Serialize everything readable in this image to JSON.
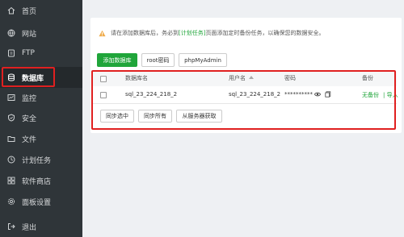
{
  "sidebar": {
    "items": [
      {
        "label": "首页",
        "icon": "home-icon"
      },
      {
        "label": "网站",
        "icon": "globe-icon"
      },
      {
        "label": "FTP",
        "icon": "ftp-icon"
      },
      {
        "label": "数据库",
        "icon": "database-icon",
        "active": true
      },
      {
        "label": "监控",
        "icon": "monitor-icon"
      },
      {
        "label": "安全",
        "icon": "shield-icon"
      },
      {
        "label": "文件",
        "icon": "folder-icon"
      },
      {
        "label": "计划任务",
        "icon": "clock-icon"
      },
      {
        "label": "软件商店",
        "icon": "store-icon"
      },
      {
        "label": "面板设置",
        "icon": "gear-icon"
      },
      {
        "label": "退出",
        "icon": "logout-icon"
      }
    ]
  },
  "tip": {
    "before": "请在添加数据库后，务必到",
    "link": "[计划任务]",
    "after": "页面添加定时备份任务，以确保您的数据安全。"
  },
  "toolbar": {
    "add_label": "添加数据库",
    "root_label": "root密码",
    "pma_label": "phpMyAdmin"
  },
  "table": {
    "headers": {
      "name": "数据库名",
      "user": "用户名",
      "password": "密码",
      "backup": "备份"
    },
    "rows": [
      {
        "name": "sql_23_224_218_2",
        "user": "sql_23_224_218_2",
        "password": "**********",
        "backup": "无备份",
        "import": "| 导入"
      }
    ]
  },
  "sync": {
    "selected": "同步选中",
    "all": "同步所有",
    "from_server": "从服务器获取"
  },
  "colors": {
    "accent": "#20a53a",
    "sidebar": "#2f3539",
    "highlight": "#e02020"
  }
}
